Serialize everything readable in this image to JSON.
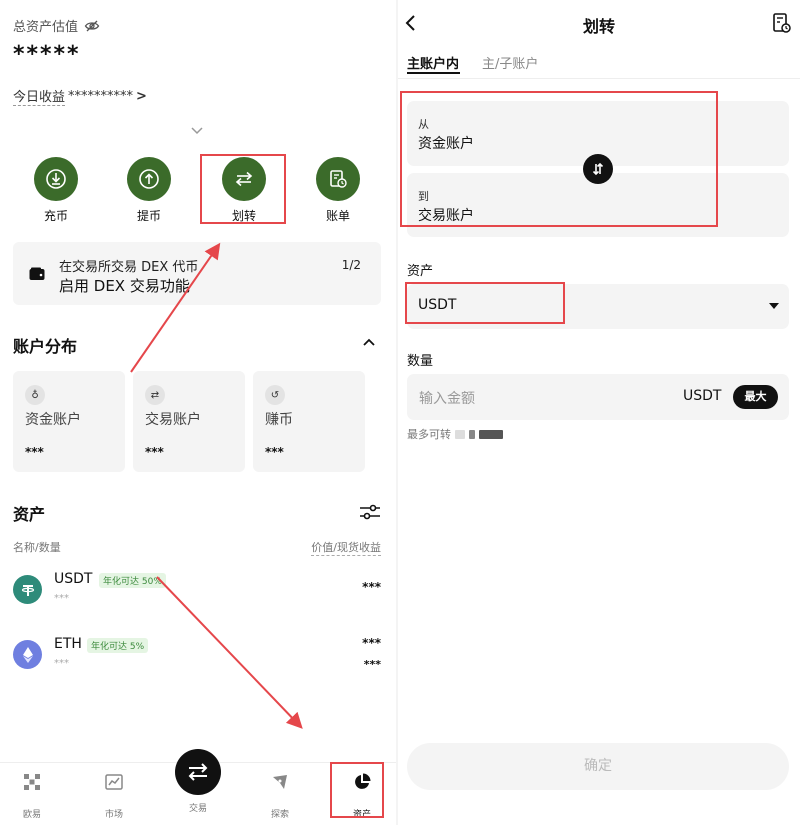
{
  "left": {
    "total_label": "总资产估值",
    "total_value": "*****",
    "today_label": "今日收益",
    "today_value": "**********",
    "today_chev": ">",
    "actions": [
      {
        "label": "充币",
        "icon": "deposit-icon"
      },
      {
        "label": "提币",
        "icon": "withdraw-icon"
      },
      {
        "label": "划转",
        "icon": "transfer-icon"
      },
      {
        "label": "账单",
        "icon": "bill-icon"
      }
    ],
    "banner": {
      "line1": "在交易所交易 DEX 代币",
      "line2": "启用 DEX 交易功能",
      "pager": "1/2",
      "icon": "wallet-icon"
    },
    "distribution_title": "账户分布",
    "accounts": [
      {
        "name": "资金账户",
        "value": "***",
        "icon": "funding-icon",
        "glyph": "♁"
      },
      {
        "name": "交易账户",
        "value": "***",
        "icon": "trading-icon",
        "glyph": "⇄"
      },
      {
        "name": "赚币",
        "value": "***",
        "icon": "earn-icon",
        "glyph": "↺"
      }
    ],
    "assets_title": "资产",
    "col_name": "名称/数量",
    "col_value": "价值/现货收益",
    "assets": [
      {
        "symbol": "USDT",
        "badge": "年化可达 50%",
        "qty": "***",
        "value": "***",
        "value2": "",
        "color": "#2e8b7a",
        "icon": "usdt-icon"
      },
      {
        "symbol": "ETH",
        "badge": "年化可达 5%",
        "qty": "***",
        "value": "***",
        "value2": "***",
        "color": "#6f7fe0",
        "icon": "eth-icon"
      }
    ],
    "tabs": [
      {
        "label": "欧易",
        "icon": "okx-logo-icon"
      },
      {
        "label": "市场",
        "icon": "market-chart-icon"
      },
      {
        "label": "交易",
        "icon": "trade-swap-icon"
      },
      {
        "label": "探索",
        "icon": "explore-icon"
      },
      {
        "label": "资产",
        "icon": "assets-pie-icon"
      }
    ]
  },
  "right": {
    "title": "划转",
    "tab_active": "主账户内",
    "tab_inactive": "主/子账户",
    "from_label": "从",
    "from_value": "资金账户",
    "to_label": "到",
    "to_value": "交易账户",
    "asset_label": "资产",
    "asset_value": "USDT",
    "qty_label": "数量",
    "amount_placeholder": "输入金额",
    "amount_unit": "USDT",
    "max_label": "最大",
    "max_avail_label": "最多可转",
    "confirm_label": "确定"
  },
  "colors": {
    "accent_green": "#3b6b2a",
    "highlight_red": "#e5474b",
    "badge_green": "#3c8a3c"
  }
}
